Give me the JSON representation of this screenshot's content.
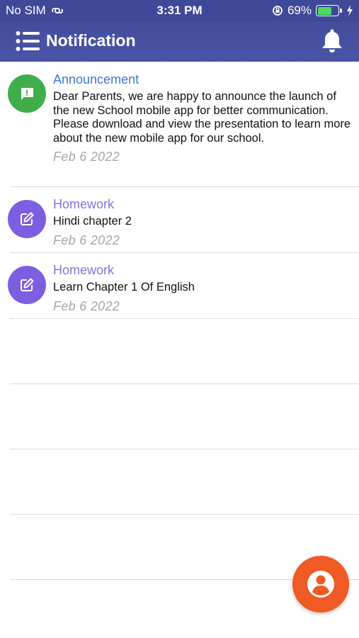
{
  "status_bar": {
    "carrier": "No SIM",
    "time": "3:31 PM",
    "battery_percent": "69%",
    "battery_level": 0.69
  },
  "header": {
    "title": "Notification"
  },
  "notifications": [
    {
      "category": "Announcement",
      "message": "Dear Parents, we are happy to announce the launch of the new School mobile app for better communication. Please download and view the presentation to learn more about the new mobile app for our school.",
      "date": "Feb  6 2022",
      "icon": "message-alert-icon"
    },
    {
      "category": "Homework",
      "message": "Hindi chapter 2",
      "date": "Feb  6 2022",
      "icon": "edit-icon"
    },
    {
      "category": "Homework",
      "message": "Learn Chapter 1 Of English",
      "date": "Feb  6 2022",
      "icon": "edit-icon"
    }
  ],
  "colors": {
    "header": "#434d9e",
    "announcement": "#3a78d6",
    "homework": "#8a6fe0",
    "announcement_icon_bg": "#3fae4a",
    "homework_icon_bg": "#7d5ee0",
    "fab": "#f05a24"
  }
}
